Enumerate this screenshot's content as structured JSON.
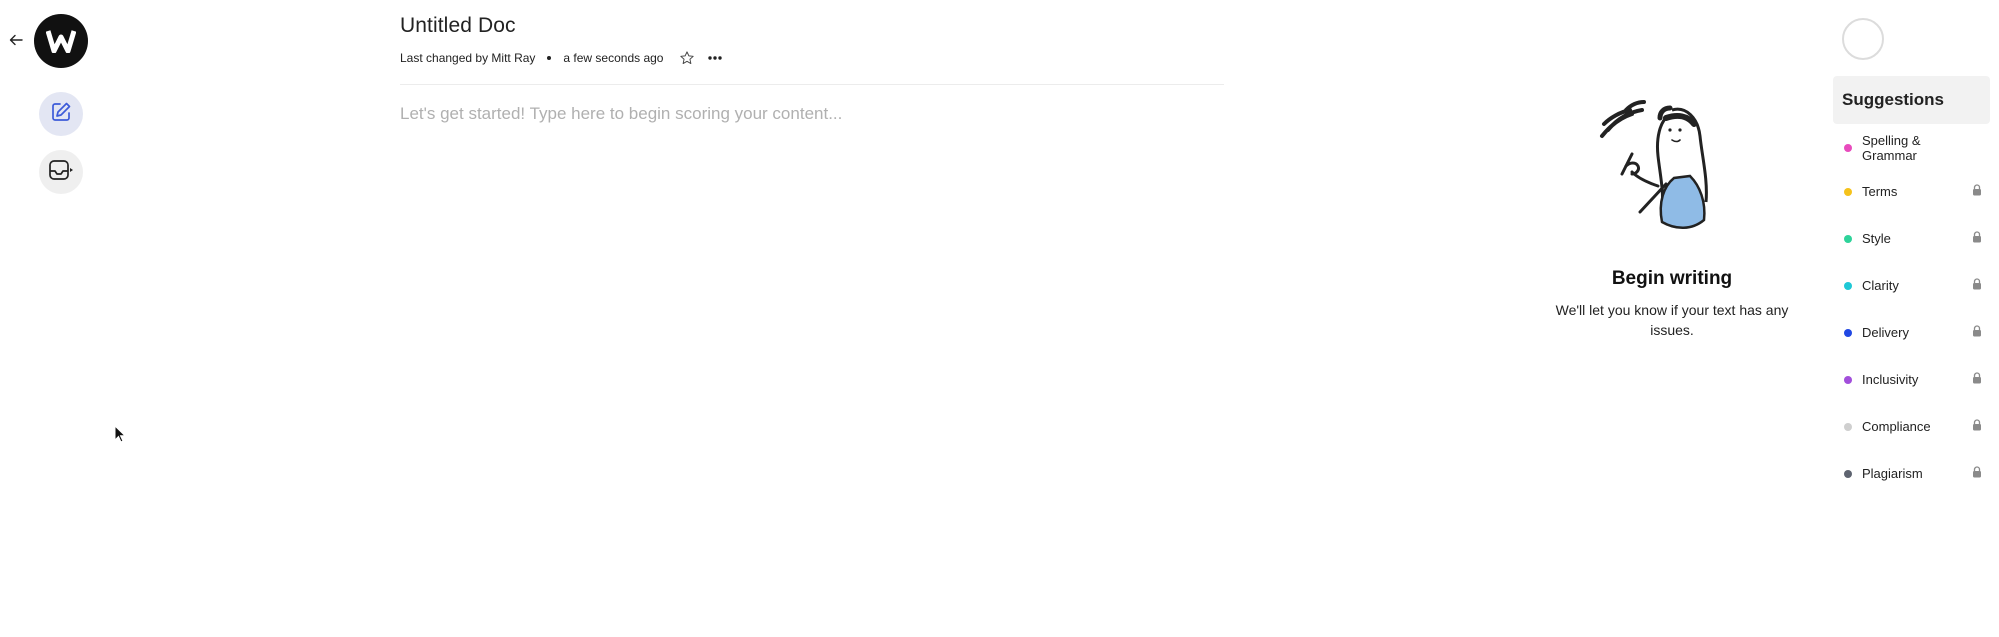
{
  "document": {
    "title": "Untitled Doc",
    "last_changed": "Last changed by Mitt Ray",
    "time_ago": "a few seconds ago",
    "placeholder": "Let's get started! Type here to begin scoring your content..."
  },
  "empty_state": {
    "title": "Begin writing",
    "subtitle": "We'll let you know if your text has any issues."
  },
  "suggestions": {
    "heading": "Suggestions",
    "items": [
      {
        "label": "Spelling & Grammar",
        "color": "#e84bbd",
        "locked": false
      },
      {
        "label": "Terms",
        "color": "#f5c21b",
        "locked": true
      },
      {
        "label": "Style",
        "color": "#2ed39a",
        "locked": true
      },
      {
        "label": "Clarity",
        "color": "#1ec8d6",
        "locked": true
      },
      {
        "label": "Delivery",
        "color": "#2148e3",
        "locked": true
      },
      {
        "label": "Inclusivity",
        "color": "#a24fdb",
        "locked": true
      },
      {
        "label": "Compliance",
        "color": "#cfcfcf",
        "locked": true
      },
      {
        "label": "Plagiarism",
        "color": "#5e6470",
        "locked": true
      }
    ]
  },
  "icons": {
    "back": "arrow-left-icon",
    "logo": "writer-logo",
    "edit": "edit-document-icon",
    "inbox": "inbox-export-icon",
    "star": "star-outline-icon",
    "more": "more-horizontal-icon",
    "lock": "lock-icon",
    "avatar": "user-avatar"
  }
}
